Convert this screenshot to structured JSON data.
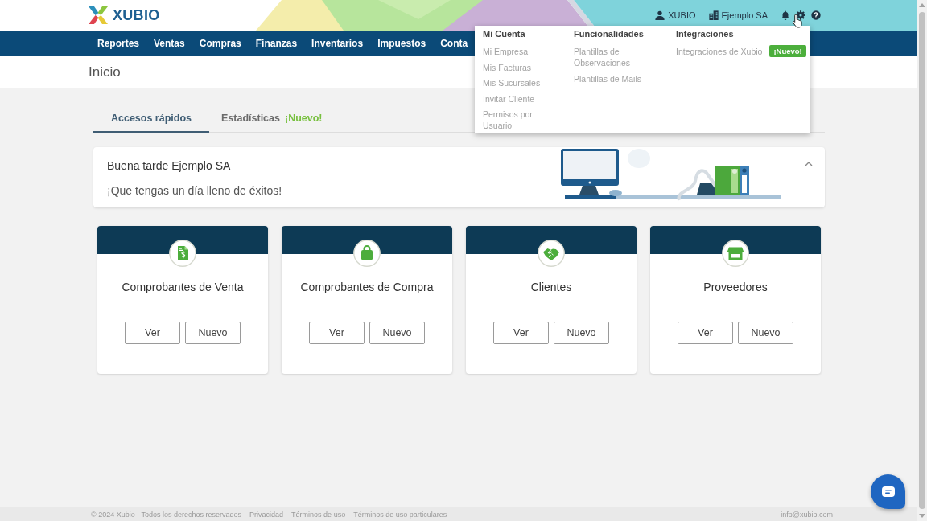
{
  "header": {
    "logo": "XUBIO",
    "user": "XUBIO",
    "company": "Ejemplo SA"
  },
  "nav": [
    "Reportes",
    "Ventas",
    "Compras",
    "Finanzas",
    "Inventarios",
    "Impuestos",
    "Conta"
  ],
  "settings_menu": {
    "columns": [
      {
        "heading": "Mi Cuenta",
        "items": [
          {
            "label": "Mi Empresa"
          },
          {
            "label": "Mis Facturas"
          },
          {
            "label": "Mis Sucursales"
          },
          {
            "label": "Invitar Cliente"
          },
          {
            "label": "Permisos por Usuario"
          }
        ]
      },
      {
        "heading": "Funcionalidades",
        "items": [
          {
            "label": "Plantillas de Observaciones"
          },
          {
            "label": "Plantillas de Mails"
          }
        ]
      },
      {
        "heading": "Integraciones",
        "items": [
          {
            "label": "Integraciones de Xubio",
            "badge": "¡Nuevo!"
          }
        ]
      }
    ]
  },
  "page_title": "Inicio",
  "tabs": [
    {
      "label": "Accesos rápidos",
      "selected": true
    },
    {
      "label": "Estadísticas",
      "badge": "¡Nuevo!",
      "selected": false
    }
  ],
  "greeting": {
    "title": "Buena tarde Ejemplo SA",
    "message": "¡Que tengas un día lleno de éxitos!",
    "expanded": true
  },
  "shortcuts": [
    {
      "kind": "invoice",
      "title": "Comprobantes de Venta",
      "actions": [
        "Ver",
        "Nuevo"
      ]
    },
    {
      "kind": "bag",
      "title": "Comprobantes de Compra",
      "actions": [
        "Ver",
        "Nuevo"
      ]
    },
    {
      "kind": "handshake",
      "title": "Clientes",
      "actions": [
        "Ver",
        "Nuevo"
      ]
    },
    {
      "kind": "store",
      "title": "Proveedores",
      "actions": [
        "Ver",
        "Nuevo"
      ]
    }
  ],
  "footer": {
    "copyright": "© 2024 Xubio - Todos los derechos reservados",
    "links": [
      "Privacidad",
      "Términos de uso",
      "Términos de uso particulares"
    ],
    "email": "info@xubio.com"
  }
}
